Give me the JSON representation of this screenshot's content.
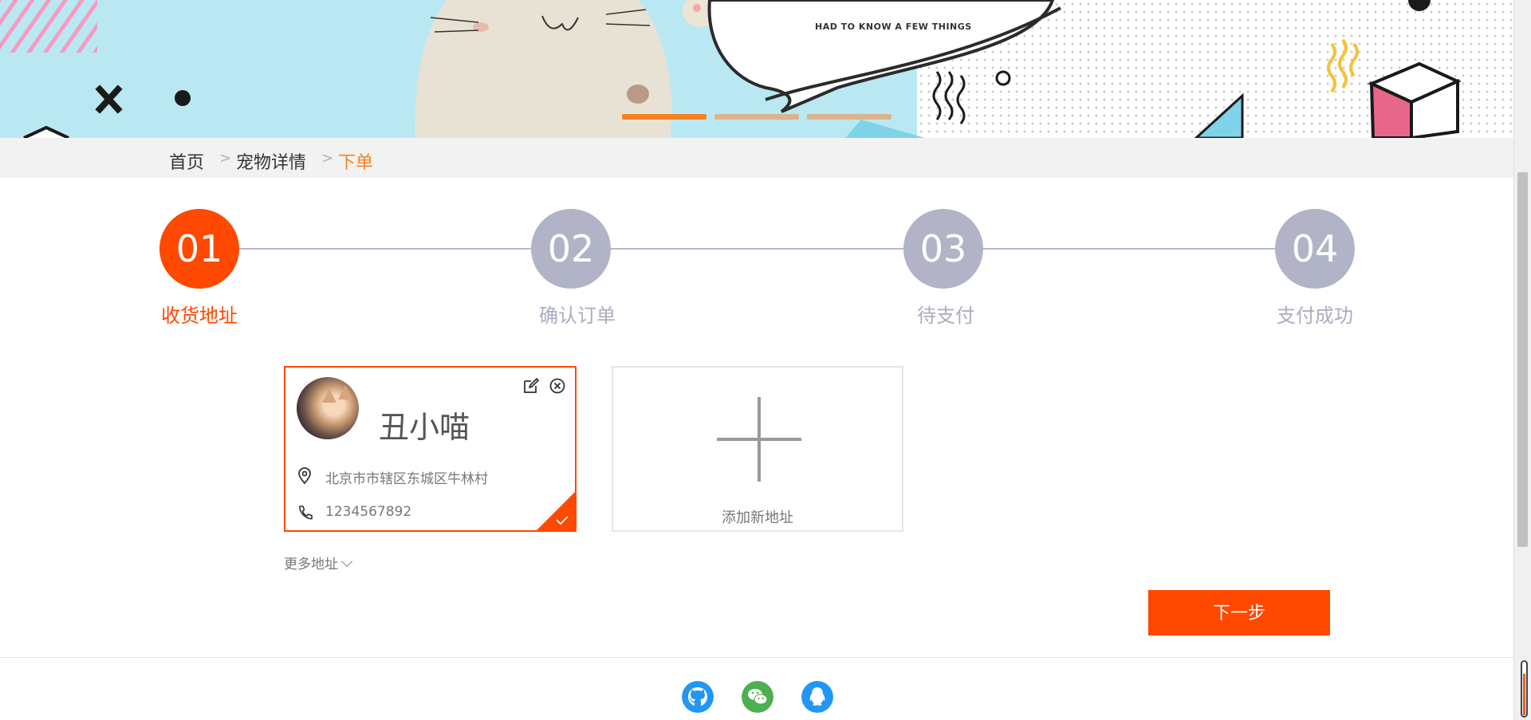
{
  "banner": {
    "tagline": "HAD TO KNOW A FEW THINGS",
    "slides": [
      {
        "state": "active",
        "color": "#f58220"
      },
      {
        "state": "inactive",
        "color": "#dcb48a"
      },
      {
        "state": "inactive",
        "color": "#dcb48a"
      }
    ]
  },
  "breadcrumb": {
    "items": [
      "首页",
      "宠物详情",
      "下单"
    ],
    "separator": ">"
  },
  "steps": [
    {
      "number": "01",
      "label": "收货地址",
      "state": "active"
    },
    {
      "number": "02",
      "label": "确认订单",
      "state": "pending"
    },
    {
      "number": "03",
      "label": "待支付",
      "state": "pending"
    },
    {
      "number": "04",
      "label": "支付成功",
      "state": "pending"
    }
  ],
  "address_card": {
    "name": "丑小喵",
    "address": "北京市市辖区东城区牛林村",
    "phone": "1234567892",
    "selected": true
  },
  "add_address": {
    "label": "添加新地址"
  },
  "more_addresses": {
    "label": "更多地址"
  },
  "next_button": {
    "label": "下一步"
  },
  "footer": {
    "icons": [
      "github-icon",
      "wechat-icon",
      "qq-icon"
    ]
  },
  "colors": {
    "accent": "#ff4800",
    "breadcrumb_active": "#f58220",
    "step_inactive": "#b1b4c6",
    "wechat": "#4caf50",
    "github": "#2196f3",
    "qq": "#2196f3"
  }
}
